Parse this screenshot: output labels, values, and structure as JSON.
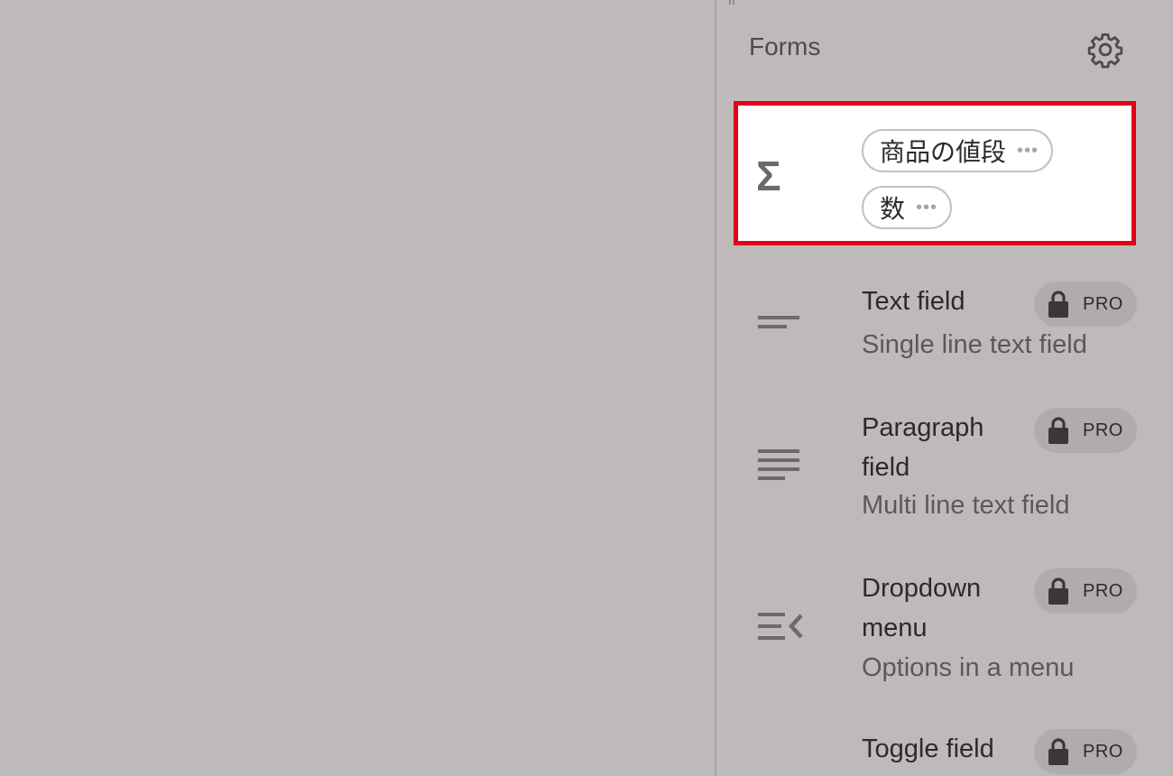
{
  "panel": {
    "title": "Forms",
    "settings_icon": "gear-icon"
  },
  "selected_block": {
    "icon": "sigma-icon",
    "icon_glyph": "Σ",
    "chips": [
      {
        "label": "商品の値段",
        "menu": "•••"
      },
      {
        "label": "数",
        "menu": "•••"
      }
    ],
    "highlight_color": "#e2001a"
  },
  "items": [
    {
      "title": "Text field",
      "description": "Single line text field",
      "icon": "text-field-icon",
      "badge": "PRO",
      "badge_icon": "lock-icon"
    },
    {
      "title": "Paragraph field",
      "description": "Multi line text field",
      "icon": "paragraph-icon",
      "badge": "PRO",
      "badge_icon": "lock-icon"
    },
    {
      "title": "Dropdown menu",
      "description": "Options in a menu",
      "icon": "dropdown-menu-icon",
      "badge": "PRO",
      "badge_icon": "lock-icon"
    },
    {
      "title": "Toggle field",
      "description": "",
      "icon": "toggle-icon",
      "badge": "PRO",
      "badge_icon": "lock-icon"
    }
  ],
  "colors": {
    "background": "#bebab9",
    "badge": "#b0acab",
    "icon": "#6e6a69"
  }
}
